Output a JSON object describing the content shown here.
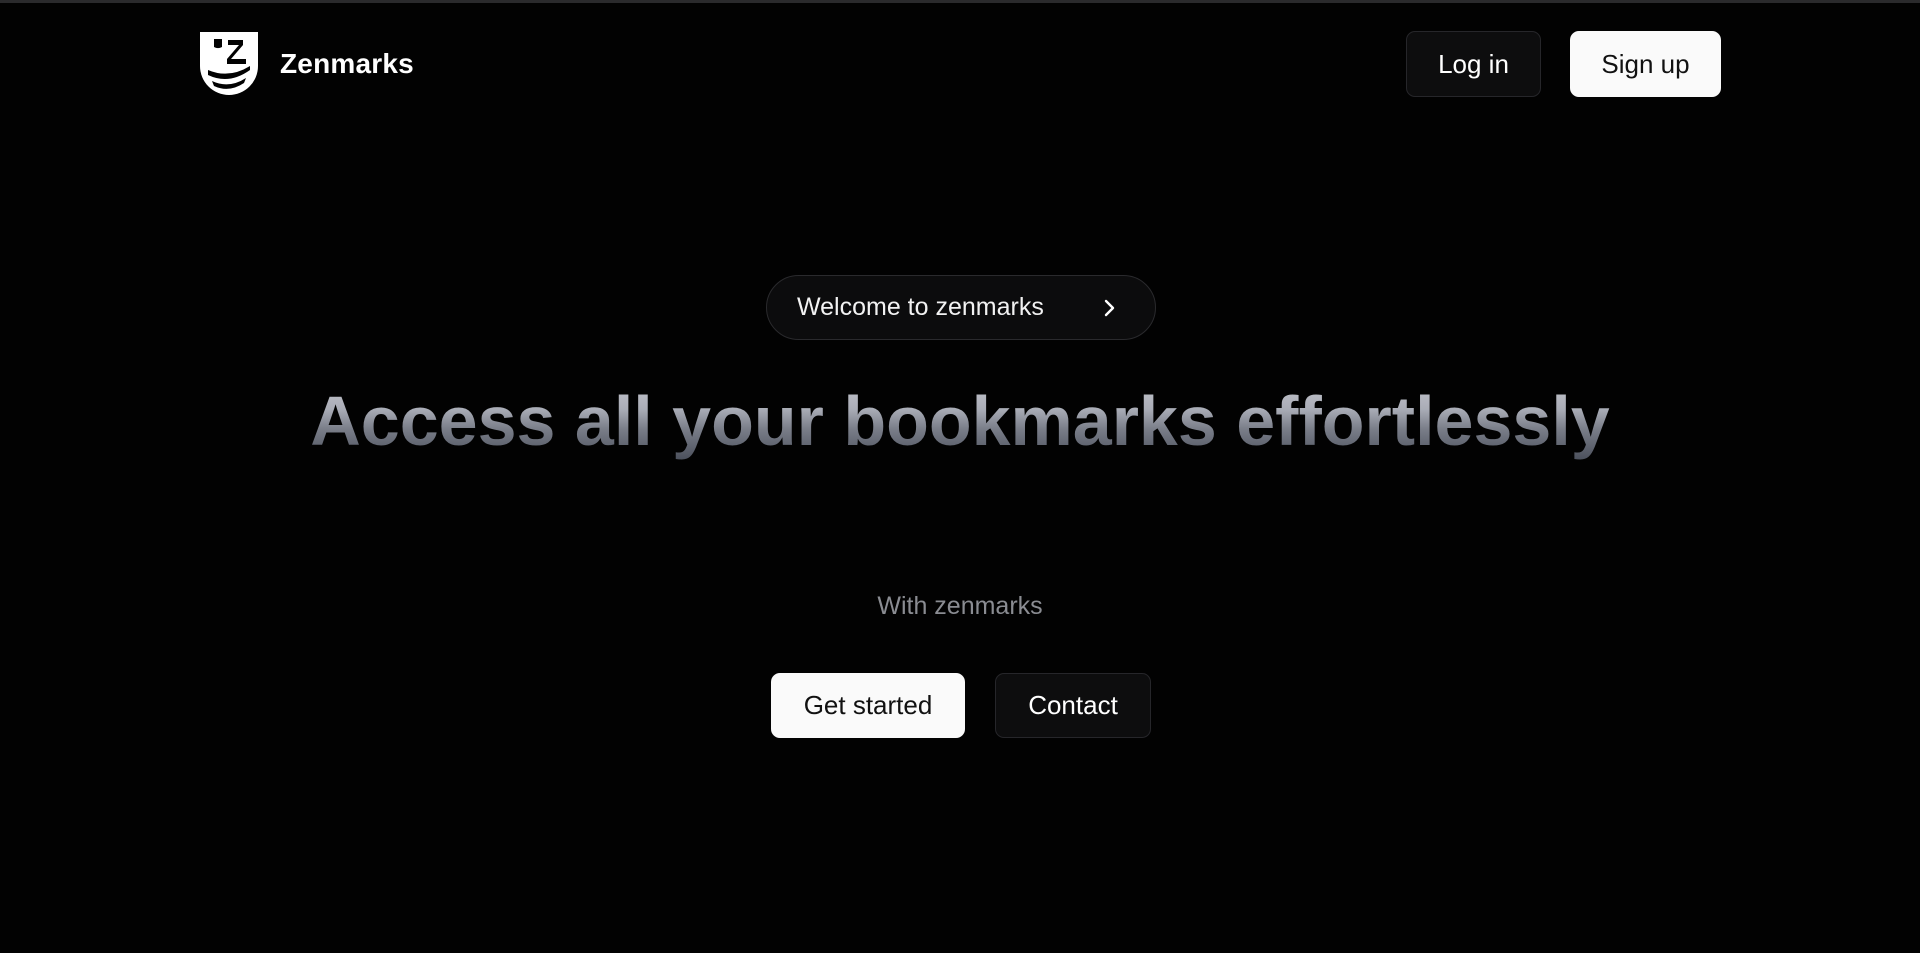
{
  "brand": {
    "name": "Zenmarks",
    "logo_icon": "zenmarks-shield-logo-icon"
  },
  "nav": {
    "login_label": "Log in",
    "signup_label": "Sign up"
  },
  "hero": {
    "pill_label": "Welcome to zenmarks",
    "pill_icon": "chevron-right-icon",
    "headline": "Access all your bookmarks effortlessly",
    "subtitle": "With zenmarks",
    "cta_primary": "Get started",
    "cta_secondary": "Contact"
  },
  "colors": {
    "background": "#020202",
    "primary_button_bg": "#fafafa",
    "secondary_button_bg": "#0d0d0e",
    "headline_gradient_top": "#c4c6cd",
    "headline_gradient_bottom": "#4b505c",
    "subtitle": "#8a8c92"
  }
}
